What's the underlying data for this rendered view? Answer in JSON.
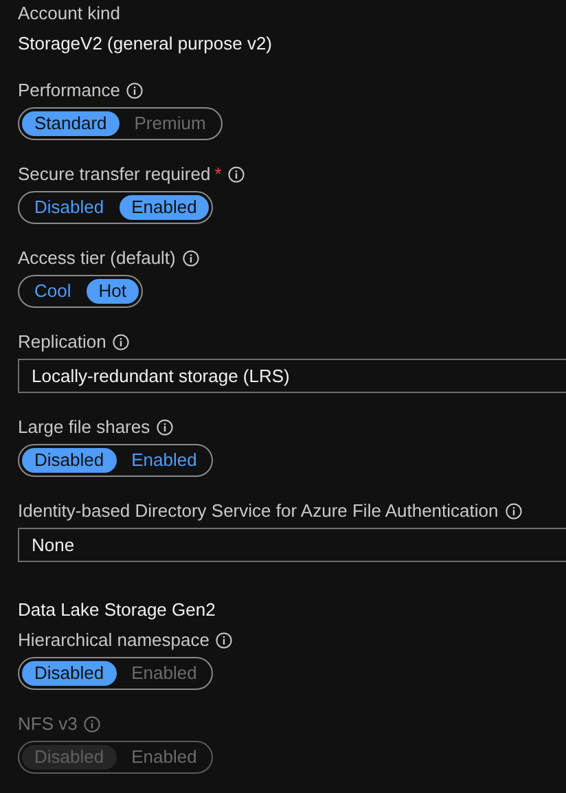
{
  "fields": [
    {
      "kind": "readonly",
      "label": "Account kind",
      "value": "StorageV2 (general purpose v2)"
    },
    {
      "kind": "toggle",
      "label": "Performance",
      "info": true,
      "disabled": false,
      "options": [
        {
          "label": "Standard",
          "selected": true,
          "disabled": false
        },
        {
          "label": "Premium",
          "selected": false,
          "disabled": true
        }
      ]
    },
    {
      "kind": "toggle",
      "label": "Secure transfer required",
      "required_mark": "*",
      "info": true,
      "disabled": false,
      "options": [
        {
          "label": "Disabled",
          "selected": false,
          "disabled": false
        },
        {
          "label": "Enabled",
          "selected": true,
          "disabled": false
        }
      ]
    },
    {
      "kind": "toggle",
      "label": "Access tier (default)",
      "info": true,
      "disabled": false,
      "options": [
        {
          "label": "Cool",
          "selected": false,
          "disabled": false
        },
        {
          "label": "Hot",
          "selected": true,
          "disabled": false
        }
      ]
    },
    {
      "kind": "dropdown",
      "label": "Replication",
      "info": true,
      "value": "Locally-redundant storage (LRS)"
    },
    {
      "kind": "toggle",
      "label": "Large file shares",
      "info": true,
      "disabled": false,
      "options": [
        {
          "label": "Disabled",
          "selected": true,
          "disabled": false
        },
        {
          "label": "Enabled",
          "selected": false,
          "disabled": false
        }
      ]
    },
    {
      "kind": "dropdown",
      "label": "Identity-based Directory Service for Azure File Authentication",
      "info": true,
      "value": "None"
    },
    {
      "kind": "heading",
      "label": "Data Lake Storage Gen2"
    },
    {
      "kind": "toggle",
      "label": "Hierarchical namespace",
      "info": true,
      "disabled": false,
      "options": [
        {
          "label": "Disabled",
          "selected": true,
          "disabled": false
        },
        {
          "label": "Enabled",
          "selected": false,
          "disabled": true
        }
      ]
    },
    {
      "kind": "toggle",
      "label": "NFS v3",
      "info": true,
      "disabled": true,
      "options": [
        {
          "label": "Disabled",
          "selected": true,
          "disabled": true
        },
        {
          "label": "Enabled",
          "selected": false,
          "disabled": true
        }
      ]
    }
  ]
}
